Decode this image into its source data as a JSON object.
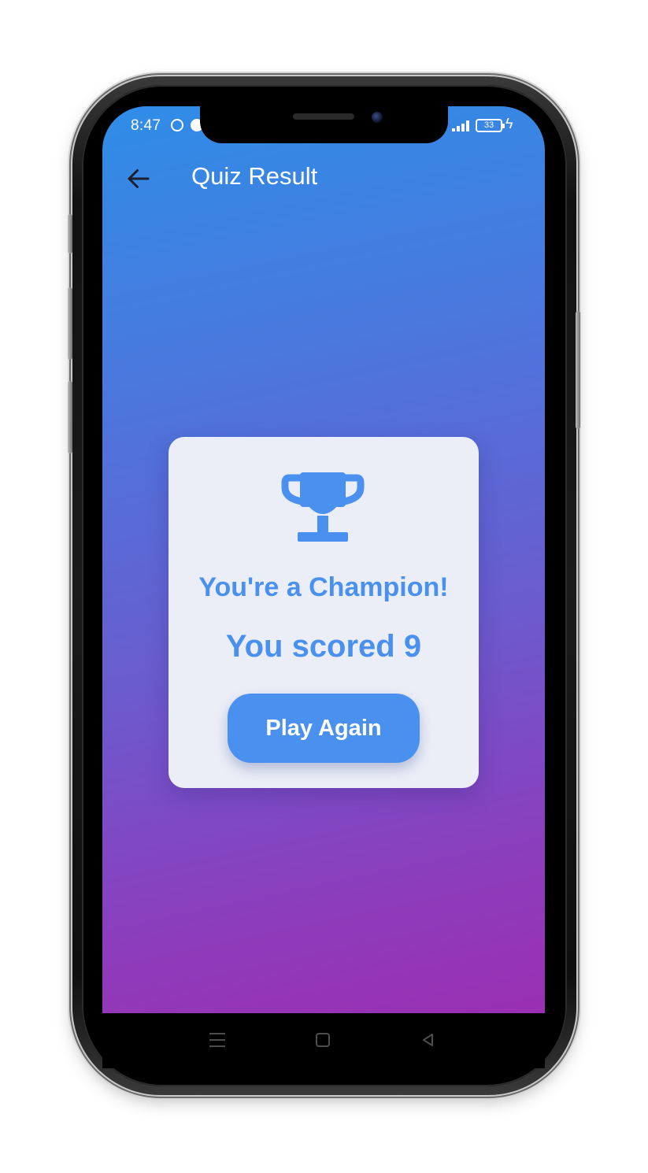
{
  "status_bar": {
    "time": "8:47",
    "battery_level": "33",
    "icons": [
      "whatsapp-icon",
      "messenger-icon",
      "signal-icon",
      "battery-icon",
      "charging-bolt-icon"
    ]
  },
  "app_bar": {
    "title": "Quiz Result",
    "back_icon": "arrow-left-icon"
  },
  "result_card": {
    "icon": "trophy-icon",
    "heading": "You're a Champion!",
    "score_text": "You scored 9",
    "button_label": "Play Again"
  },
  "nav_bar": {
    "icons": [
      "menu-icon",
      "home-icon",
      "back-icon"
    ]
  },
  "colors": {
    "accent": "#4a90ee",
    "card_bg": "#ebeef7",
    "gradient_top": "#2f8de8",
    "gradient_bottom": "#9a2fb3"
  }
}
